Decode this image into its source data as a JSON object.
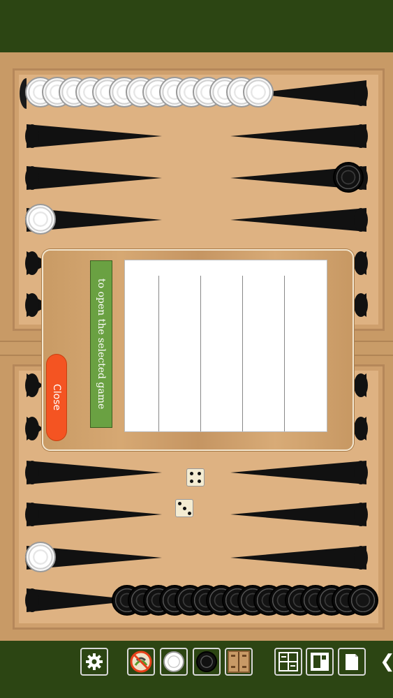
{
  "dialog": {
    "open_label": "to open the selected game",
    "close_label": "Close"
  },
  "dice": [
    4,
    3
  ],
  "colors": {
    "background": "#2c4513",
    "board": "#deb282",
    "point": "#111111",
    "close_button": "#f45422",
    "open_label_bg": "#6aa142"
  },
  "toolbar": {
    "icons": [
      "gear-icon",
      "no-sound-icon",
      "white-checker-icon",
      "black-checker-icon",
      "board-icon",
      "layout-icon",
      "save-icon",
      "page-icon",
      "back-chevron-icon"
    ],
    "back_glyph": "❮"
  }
}
